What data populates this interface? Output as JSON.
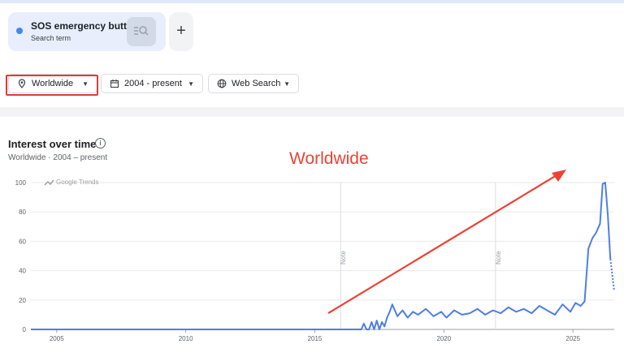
{
  "search_term": {
    "name": "SOS emergency butto",
    "type_label": "Search term",
    "color": "#4285f4"
  },
  "add_button": {
    "label": "+"
  },
  "filters": {
    "location": "Worldwide",
    "date_range": "2004 - present",
    "search_type": "Web Search"
  },
  "chart_card": {
    "title": "Interest over time",
    "subtitle": "Worldwide · 2004 – present",
    "watermark": "Google Trends",
    "note_labels": [
      "Note",
      "Note"
    ]
  },
  "annotation": {
    "text": "Worldwide",
    "color": "#ea4335"
  },
  "chart_data": {
    "type": "line",
    "x_tick_labels": [
      "2005",
      "2010",
      "2015",
      "2020",
      "2025"
    ],
    "y_tick_labels": [
      "100",
      "80",
      "60",
      "40",
      "20",
      "0"
    ],
    "ylim": [
      0,
      100
    ],
    "xlim": [
      2004.0,
      2026.6
    ],
    "notes_at": [
      2016.0,
      2022.0
    ],
    "line_color": "#4e7ee6",
    "series": [
      {
        "x": [
          2004.0,
          2016.8,
          2016.9,
          2017.0,
          2017.1,
          2017.2,
          2017.3,
          2017.4,
          2017.5,
          2017.6,
          2017.7,
          2017.8,
          2017.9,
          2018.0,
          2018.2,
          2018.4,
          2018.6,
          2018.8,
          2019.0,
          2019.3,
          2019.6,
          2019.9,
          2020.1,
          2020.4,
          2020.7,
          2021.0,
          2021.3,
          2021.6,
          2021.9,
          2022.2,
          2022.5,
          2022.8,
          2023.1,
          2023.4,
          2023.7,
          2024.0,
          2024.3,
          2024.6,
          2024.9,
          2025.1,
          2025.3,
          2025.45,
          2025.6,
          2025.75,
          2025.9,
          2026.05,
          2026.15,
          2026.25,
          2026.35,
          2026.45
        ],
        "y": [
          0,
          0,
          4,
          0,
          0,
          5,
          0,
          6,
          0,
          5,
          2,
          8,
          12,
          17,
          9,
          13,
          8,
          12,
          10,
          14,
          9,
          12,
          8,
          13,
          10,
          11,
          14,
          10,
          13,
          11,
          15,
          12,
          14,
          11,
          16,
          13,
          10,
          17,
          12,
          18,
          16,
          19,
          55,
          62,
          66,
          72,
          99,
          100,
          78,
          48
        ]
      }
    ],
    "partial_segment": {
      "x": [
        2026.45,
        2026.6
      ],
      "y": [
        48,
        26
      ]
    }
  }
}
